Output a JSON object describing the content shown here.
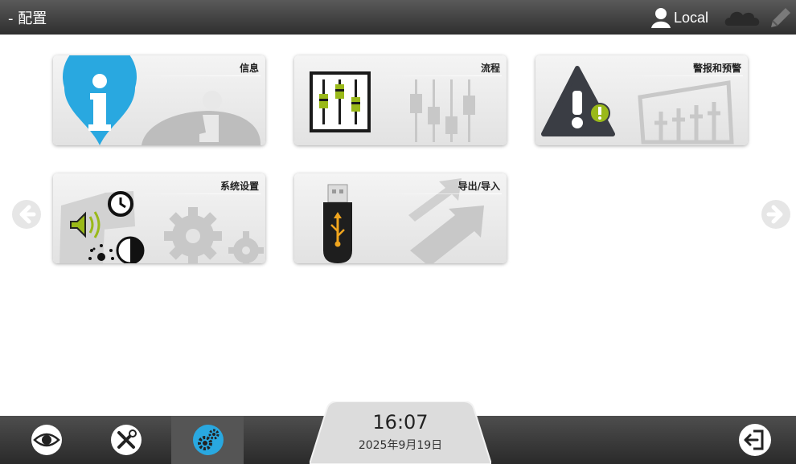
{
  "header": {
    "title": "- 配置",
    "user_label": "Local"
  },
  "tiles": [
    {
      "label": "信息",
      "icon": "info-icon"
    },
    {
      "label": "流程",
      "icon": "sliders-icon"
    },
    {
      "label": "警报和预警",
      "icon": "warning-icon"
    },
    {
      "label": "系统设置",
      "icon": "system-settings-icon"
    },
    {
      "label": "导出/导入",
      "icon": "usb-drive-icon"
    }
  ],
  "footer": {
    "time": "16:07",
    "date": "2025年9月19日",
    "nav": [
      "eye-icon",
      "tools-icon",
      "gears-icon"
    ],
    "active_index": 2
  },
  "colors": {
    "accent_blue": "#29a8e0",
    "accent_green": "#9ab919",
    "bar_dark": "#333333"
  }
}
